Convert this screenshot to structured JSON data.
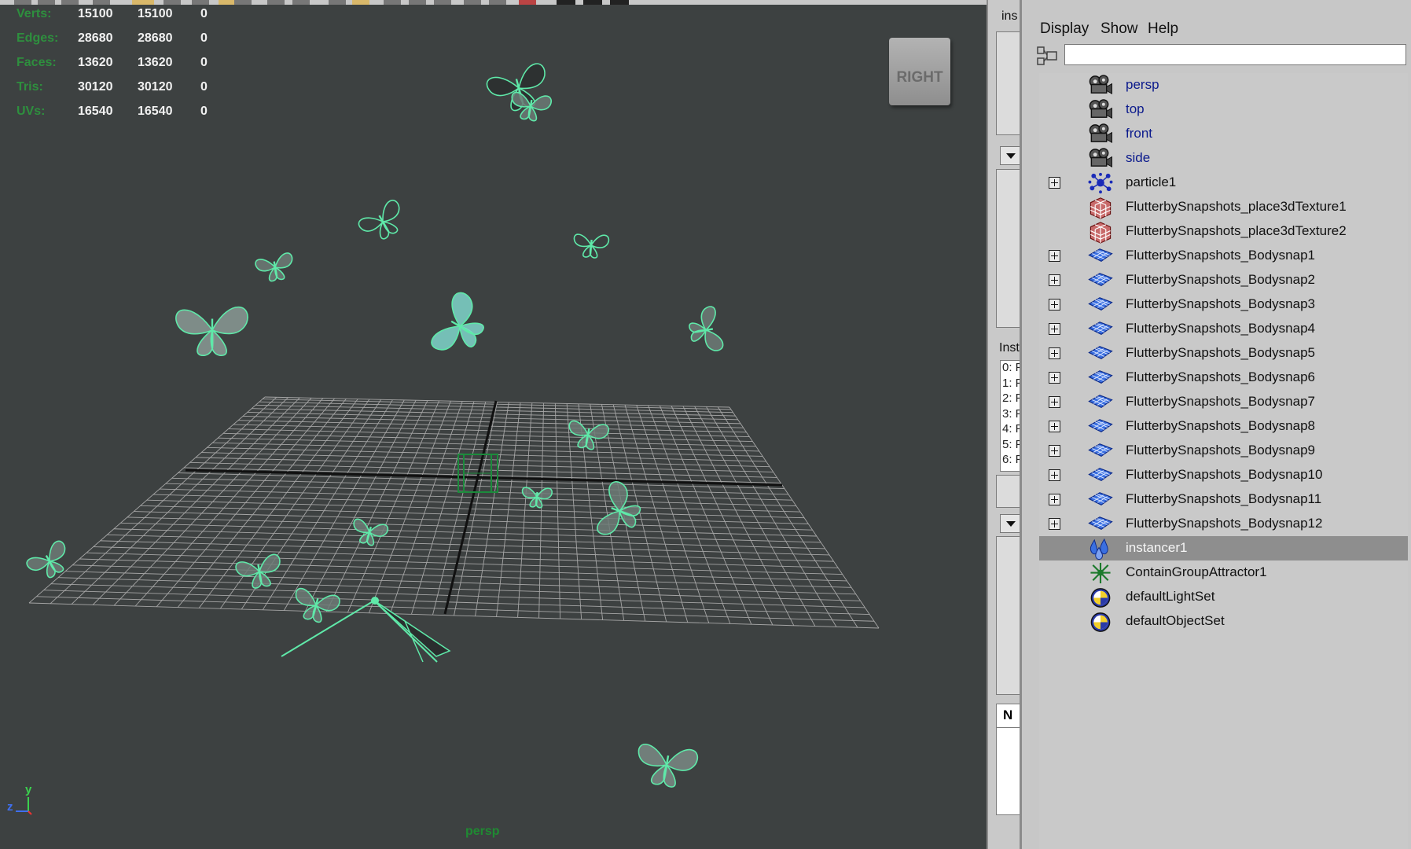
{
  "hud": {
    "rows": [
      {
        "label": "Verts:",
        "values": [
          "15100",
          "15100",
          "0"
        ]
      },
      {
        "label": "Edges:",
        "values": [
          "28680",
          "28680",
          "0"
        ]
      },
      {
        "label": "Faces:",
        "values": [
          "13620",
          "13620",
          "0"
        ]
      },
      {
        "label": "Tris:",
        "values": [
          "30120",
          "30120",
          "0"
        ]
      },
      {
        "label": "UVs:",
        "values": [
          "16540",
          "16540",
          "0"
        ]
      }
    ]
  },
  "viewport": {
    "camera": "persp",
    "viewcube_label": "RIGHT",
    "axis_y": "y",
    "axis_z": "z",
    "colors": {
      "background": "#3d4141",
      "wireframe": "#5fe9a9",
      "grid": "#a6a6a6"
    }
  },
  "midpanel": {
    "top_text": "ins",
    "inst_label": "Inst",
    "list_items": [
      "0: F",
      "1: F",
      "2: F",
      "3: F",
      "4: F",
      "5: F",
      "6: F"
    ],
    "bottom_label": "N"
  },
  "outliner": {
    "menu": [
      "Display",
      "Show",
      "Help"
    ],
    "filter_value": "",
    "items": [
      {
        "name": "persp",
        "icon": "camera-icon",
        "expandable": false,
        "selected": false
      },
      {
        "name": "top",
        "icon": "camera-icon",
        "expandable": false,
        "selected": false
      },
      {
        "name": "front",
        "icon": "camera-icon",
        "expandable": false,
        "selected": false
      },
      {
        "name": "side",
        "icon": "camera-icon",
        "expandable": false,
        "selected": false
      },
      {
        "name": "particle1",
        "icon": "particle-icon",
        "expandable": true,
        "selected": false
      },
      {
        "name": "FlutterbySnapshots_place3dTexture1",
        "icon": "texture-cube-icon",
        "expandable": false,
        "selected": false
      },
      {
        "name": "FlutterbySnapshots_place3dTexture2",
        "icon": "texture-cube-icon",
        "expandable": false,
        "selected": false
      },
      {
        "name": "FlutterbySnapshots_Bodysnap1",
        "icon": "mesh-icon",
        "expandable": true,
        "selected": false
      },
      {
        "name": "FlutterbySnapshots_Bodysnap2",
        "icon": "mesh-icon",
        "expandable": true,
        "selected": false
      },
      {
        "name": "FlutterbySnapshots_Bodysnap3",
        "icon": "mesh-icon",
        "expandable": true,
        "selected": false
      },
      {
        "name": "FlutterbySnapshots_Bodysnap4",
        "icon": "mesh-icon",
        "expandable": true,
        "selected": false
      },
      {
        "name": "FlutterbySnapshots_Bodysnap5",
        "icon": "mesh-icon",
        "expandable": true,
        "selected": false
      },
      {
        "name": "FlutterbySnapshots_Bodysnap6",
        "icon": "mesh-icon",
        "expandable": true,
        "selected": false
      },
      {
        "name": "FlutterbySnapshots_Bodysnap7",
        "icon": "mesh-icon",
        "expandable": true,
        "selected": false
      },
      {
        "name": "FlutterbySnapshots_Bodysnap8",
        "icon": "mesh-icon",
        "expandable": true,
        "selected": false
      },
      {
        "name": "FlutterbySnapshots_Bodysnap9",
        "icon": "mesh-icon",
        "expandable": true,
        "selected": false
      },
      {
        "name": "FlutterbySnapshots_Bodysnap10",
        "icon": "mesh-icon",
        "expandable": true,
        "selected": false
      },
      {
        "name": "FlutterbySnapshots_Bodysnap11",
        "icon": "mesh-icon",
        "expandable": true,
        "selected": false
      },
      {
        "name": "FlutterbySnapshots_Bodysnap12",
        "icon": "mesh-icon",
        "expandable": true,
        "selected": false
      },
      {
        "name": "instancer1",
        "icon": "instancer-icon",
        "expandable": false,
        "selected": true
      },
      {
        "name": "ContainGroupAttractor1",
        "icon": "attractor-icon",
        "expandable": false,
        "selected": false
      },
      {
        "name": "defaultLightSet",
        "icon": "set-icon",
        "expandable": false,
        "selected": false
      },
      {
        "name": "defaultObjectSet",
        "icon": "set-icon",
        "expandable": false,
        "selected": false
      }
    ]
  }
}
